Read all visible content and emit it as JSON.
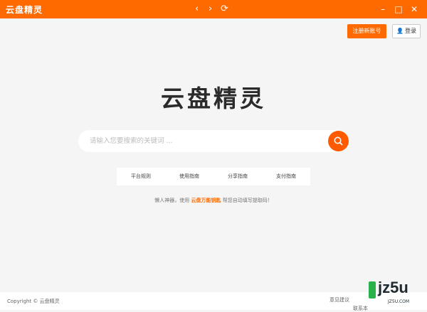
{
  "titlebar": {
    "app_name": "云盘精灵",
    "back_icon": "‹",
    "forward_icon": "›",
    "refresh_icon": "⟳",
    "minimize_icon": "–",
    "maximize_icon": "□",
    "close_icon": "✕",
    "bg_color": "#ff6a00"
  },
  "header": {
    "register_label": "注册新账号",
    "login_label": "登录",
    "user_icon": "👤"
  },
  "main": {
    "logo_text": "云盘精灵",
    "search_placeholder": "请输入您要搜索的关键词 ...",
    "search_icon": "search-icon",
    "links": [
      {
        "label": "平台规则"
      },
      {
        "label": "使用指南"
      },
      {
        "label": "分享指南"
      },
      {
        "label": "支付指南"
      }
    ],
    "hint_prefix": "懒人神器，使用",
    "hint_link": "云盘万能钥匙",
    "hint_suffix": "帮您自动填写提取码！"
  },
  "footer": {
    "copyright": "Copyright © 云盘精灵",
    "feedback": "意见建议",
    "contact": "联系本"
  },
  "watermark": {
    "text": "jz5u",
    "sub": "JZ5U.COM"
  },
  "colors": {
    "accent": "#ff6a00",
    "background": "#f5f5f5"
  }
}
